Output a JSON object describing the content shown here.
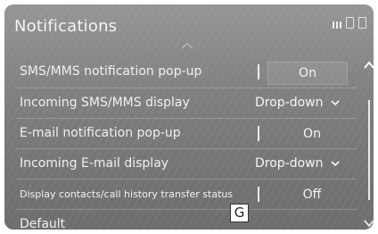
{
  "header": {
    "title": "Notifications"
  },
  "settings": [
    {
      "label": "SMS/MMS notification pop-up",
      "value": "On",
      "type": "toggle"
    },
    {
      "label": "Incoming SMS/MMS display",
      "value": "Drop-down",
      "type": "dropdown"
    },
    {
      "label": "E-mail notification pop-up",
      "value": "On",
      "type": "toggle"
    },
    {
      "label": "Incoming E-mail display",
      "value": "Drop-down",
      "type": "dropdown"
    },
    {
      "label": "Display contacts/call history transfer status",
      "value": "Off",
      "type": "toggle"
    },
    {
      "label": "Default",
      "value": "",
      "type": "action"
    }
  ],
  "badge": {
    "label": "G"
  },
  "icons": {
    "scroll_up": "chevron-up-icon",
    "scroll_down": "chevron-down-icon",
    "dropdown": "chevron-down-icon",
    "signal": "signal-icon",
    "battery": "battery-icon",
    "phone": "phone-icon"
  }
}
